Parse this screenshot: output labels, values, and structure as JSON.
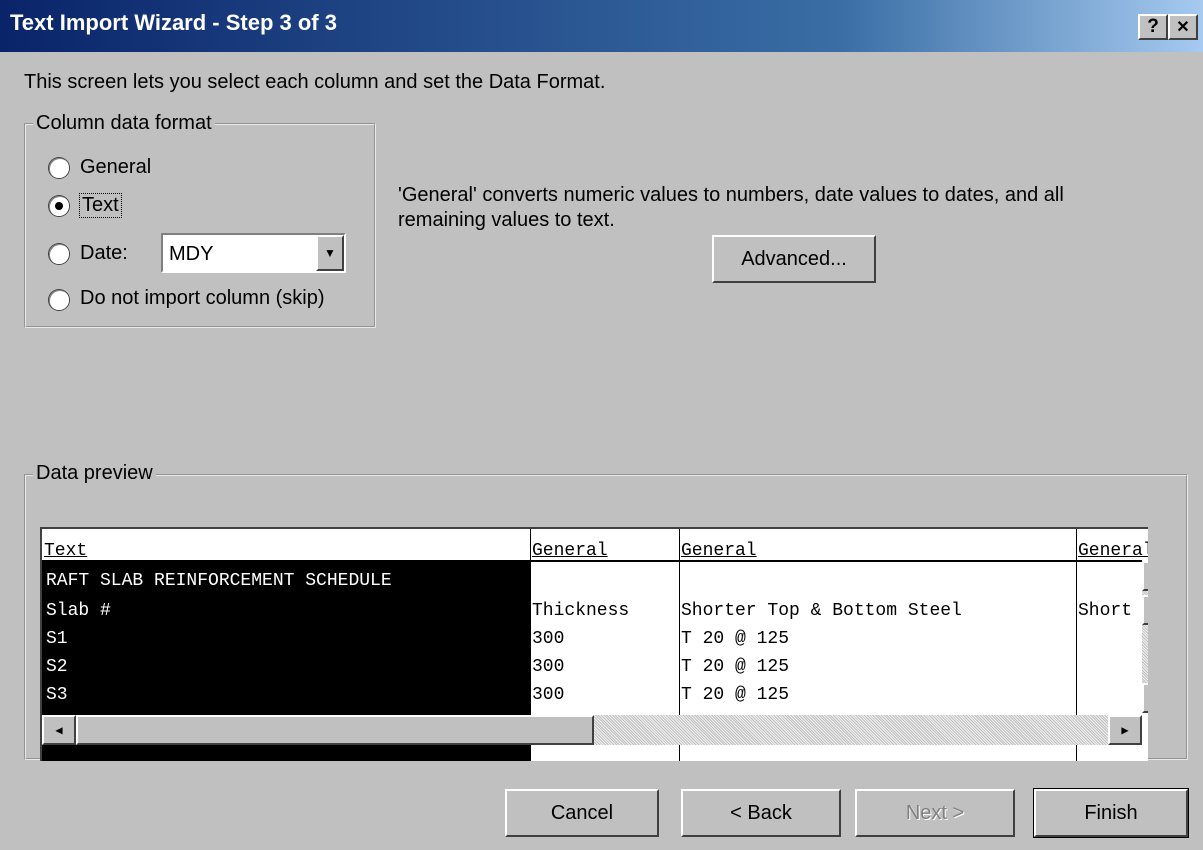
{
  "window": {
    "title": "Text Import Wizard - Step 3 of 3",
    "help_label": "?",
    "close_label": "✕"
  },
  "intro": "This screen lets you select each column and set the Data Format.",
  "column_format": {
    "legend": "Column data format",
    "options": [
      {
        "label": "General",
        "checked": false
      },
      {
        "label": "Text",
        "checked": true
      },
      {
        "label": "Date:",
        "checked": false
      },
      {
        "label": "Do not import column (skip)",
        "checked": false
      }
    ],
    "date_format": "MDY"
  },
  "description": {
    "line1": "'General' converts numeric values to numbers, date values to dates, and all",
    "line2": "remaining values to text."
  },
  "advanced_label": "Advanced...",
  "preview": {
    "legend": "Data preview",
    "headers": [
      "Text",
      "General",
      "General",
      "General"
    ],
    "rows": [
      [
        "RAFT SLAB REINFORCEMENT SCHEDULE",
        "",
        "",
        ""
      ],
      [
        "Slab #",
        "Thickness",
        "Shorter Top & Bottom Steel",
        "Short"
      ],
      [
        "S1",
        "300",
        "T 20 @ 125",
        ""
      ],
      [
        "S2",
        "300",
        "T 20 @ 125",
        ""
      ],
      [
        "S3",
        "300",
        "T 20 @ 125",
        ""
      ]
    ]
  },
  "buttons": {
    "cancel": "Cancel",
    "back": "< Back",
    "next": "Next >",
    "finish": "Finish"
  },
  "icons": {
    "help": "help-icon",
    "close": "close-icon",
    "dropdown": "chevron-down-icon"
  }
}
